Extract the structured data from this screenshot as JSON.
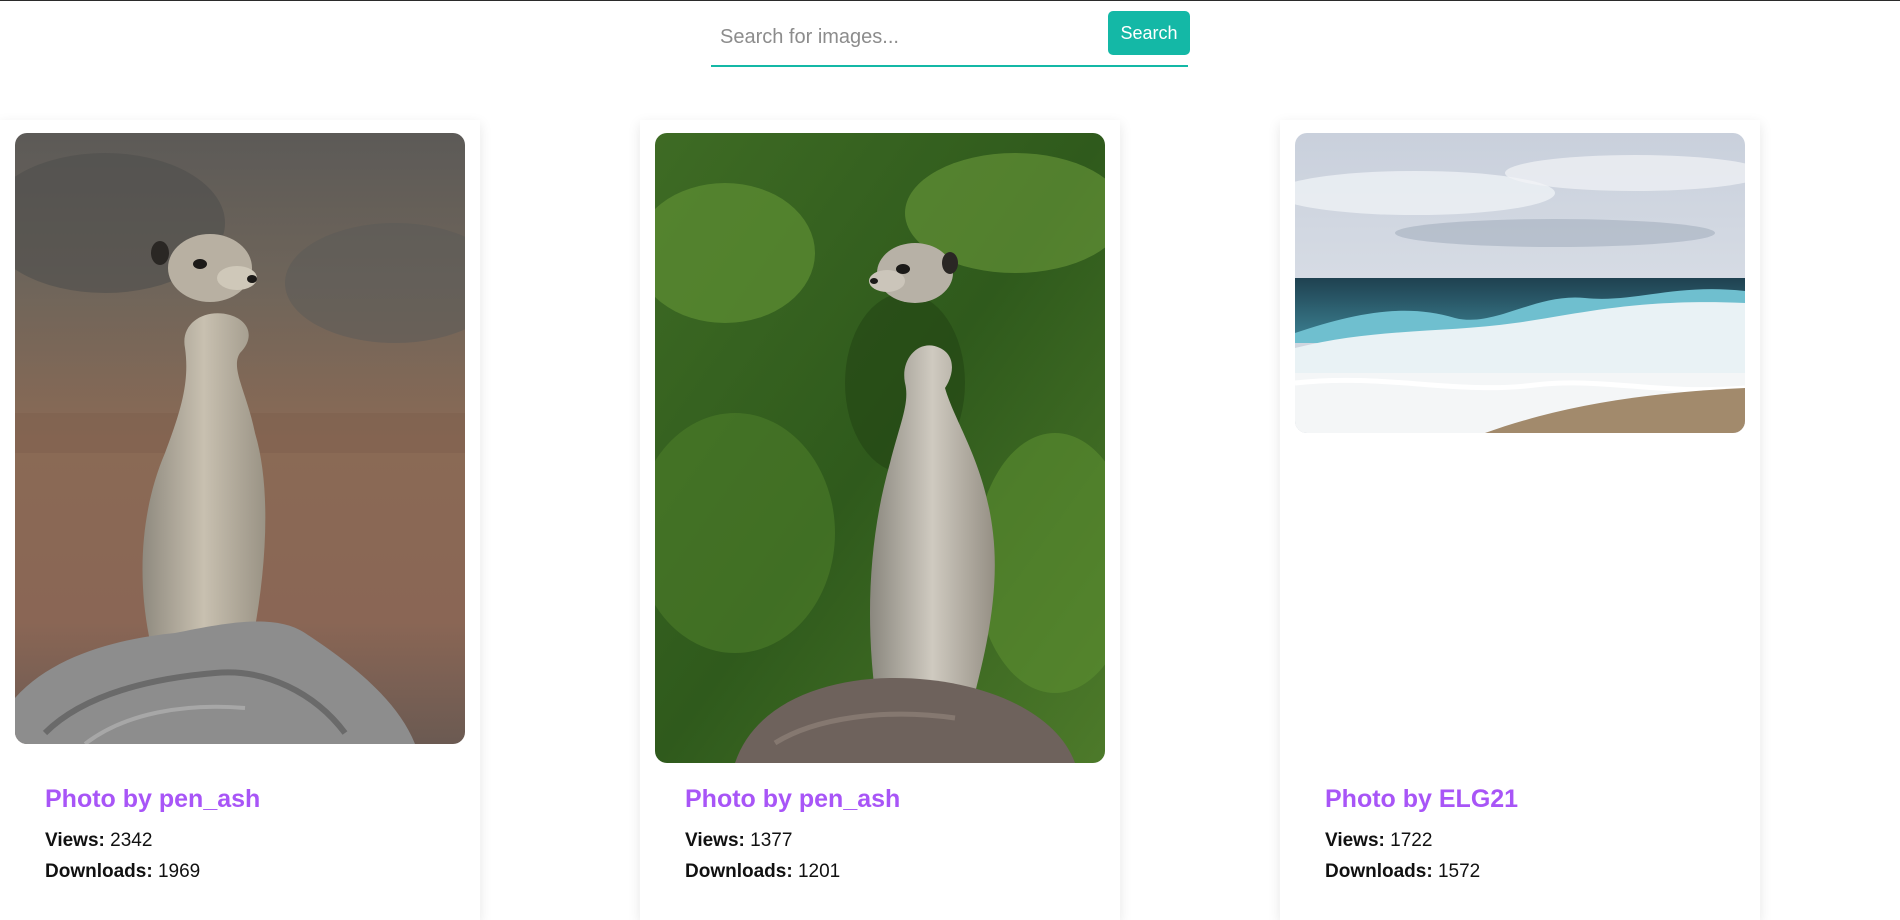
{
  "search": {
    "placeholder": "Search for images...",
    "value": "",
    "button_label": "Search"
  },
  "labels": {
    "views": "Views:",
    "downloads": "Downloads:"
  },
  "colors": {
    "accent": "#14b8a6",
    "title": "#a855f7"
  },
  "cards": [
    {
      "title": "Photo by pen_ash",
      "image": "meerkat-on-rock-image",
      "views": "2342",
      "downloads": "1969"
    },
    {
      "title": "Photo by pen_ash",
      "image": "meerkat-in-greenery-image",
      "views": "1377",
      "downloads": "1201"
    },
    {
      "title": "Photo by ELG21",
      "image": "ocean-waves-image",
      "views": "1722",
      "downloads": "1572"
    }
  ]
}
